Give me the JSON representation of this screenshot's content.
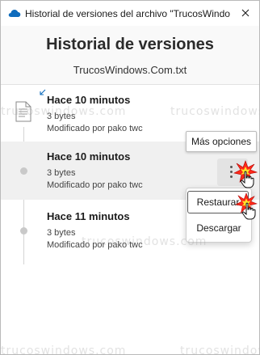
{
  "window": {
    "title": "Historial de versiones del archivo \"TrucosWindows.Com.txt\"",
    "icon": "onedrive-cloud-icon",
    "accent": "#0f6cbd"
  },
  "header": {
    "title": "Historial de versiones",
    "filename": "TrucosWindows.Com.txt"
  },
  "versions": [
    {
      "time": "Hace 10 minutos",
      "size": "3 bytes",
      "modified": "Modificado por pako twc"
    },
    {
      "time": "Hace 10 minutos",
      "size": "3 bytes",
      "modified": "Modificado por pako twc"
    },
    {
      "time": "Hace 11 minutos",
      "size": "3 bytes",
      "modified": "Modificado por pako twc"
    }
  ],
  "tooltip": {
    "more_options": "Más opciones"
  },
  "context_menu": {
    "restore": "Restaurar",
    "download": "Descargar"
  },
  "watermark": "trucoswindows.com"
}
